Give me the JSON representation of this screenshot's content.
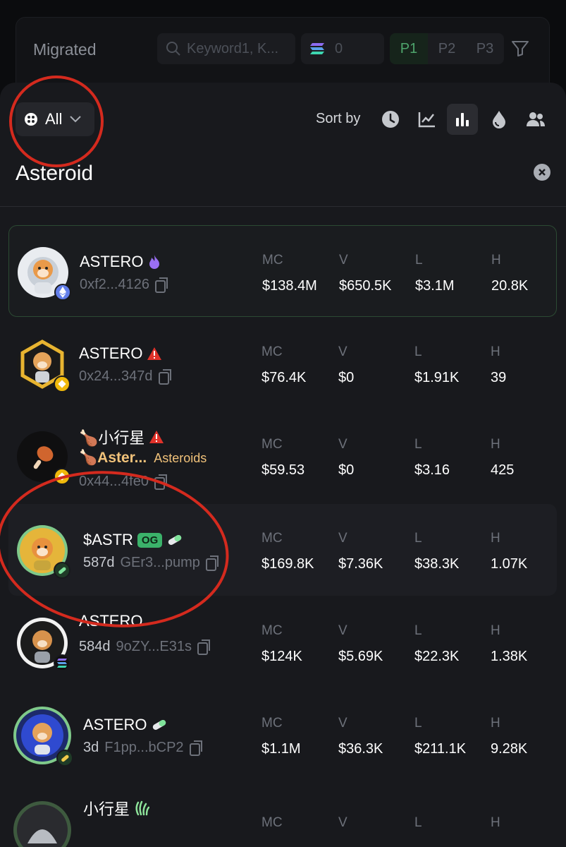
{
  "background_header": {
    "title": "Migrated",
    "search_placeholder": "Keyword1, K...",
    "sol_value": "0",
    "pages": [
      "P1",
      "P2",
      "P3"
    ]
  },
  "toolbar": {
    "filter_label": "All",
    "sort_label": "Sort by"
  },
  "query": "Asteroid",
  "stat_labels": {
    "mc": "MC",
    "v": "V",
    "l": "L",
    "h": "H"
  },
  "tokens": [
    {
      "name": "ASTERO",
      "name_icon": "fire-icon",
      "age": "",
      "address": "0xf2...4126",
      "chain": "ethereum",
      "mc": "$138.4M",
      "v": "$650.5K",
      "l": "$3.1M",
      "h": "20.8K"
    },
    {
      "name": "ASTERO",
      "name_icon": "warning-icon",
      "age": "",
      "address": "0x24...347d",
      "chain": "bnb",
      "mc": "$76.4K",
      "v": "$0",
      "l": "$1.91K",
      "h": "39"
    },
    {
      "name": "🍗小行星",
      "name_icon": "warning-icon",
      "subtitle": "🍗Aster...",
      "subtitle_tag": "Asteroids",
      "age": "",
      "address": "0x44...4fe0",
      "chain": "bnb",
      "mc": "$59.53",
      "v": "$0",
      "l": "$3.16",
      "h": "425"
    },
    {
      "name": "$ASTR",
      "badge": "OG",
      "name_icon": "pill-icon",
      "age": "587d",
      "address": "GEr3...pump",
      "chain": "pump",
      "mc": "$169.8K",
      "v": "$7.36K",
      "l": "$38.3K",
      "h": "1.07K"
    },
    {
      "name": "ASTERO",
      "name_icon": "",
      "age": "584d",
      "address": "9oZY...E31s",
      "chain": "solana",
      "mc": "$124K",
      "v": "$5.69K",
      "l": "$22.3K",
      "h": "1.38K"
    },
    {
      "name": "ASTERO",
      "name_icon": "pill-icon",
      "age": "3d",
      "address": "F1pp...bCP2",
      "chain": "pump",
      "mc": "$1.1M",
      "v": "$36.3K",
      "l": "$211.1K",
      "h": "9.28K"
    },
    {
      "name": "小行星",
      "name_icon": "wave-icon",
      "age": "",
      "address": "",
      "chain": "",
      "mc": "",
      "v": "",
      "l": "",
      "h": ""
    }
  ],
  "colors": {
    "accent_green": "#3bb26a",
    "annotation_red": "#d42a1e",
    "gold": "#f1c27a"
  }
}
